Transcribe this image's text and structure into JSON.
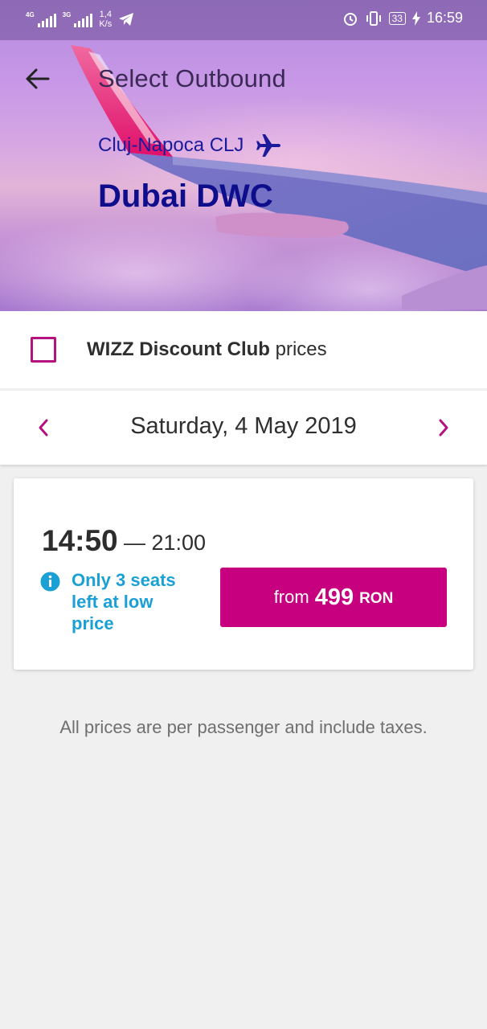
{
  "status_bar": {
    "network1": "4G",
    "network2": "3G",
    "speed_value": "1,4",
    "speed_unit": "K/s",
    "battery": "33",
    "time": "16:59",
    "icons": [
      "telegram-icon",
      "alarm-icon",
      "vibrate-icon",
      "battery-icon",
      "charging-icon"
    ]
  },
  "header": {
    "title": "Select Outbound",
    "origin": "Cluj-Napoca CLJ",
    "destination": "Dubai DWC"
  },
  "club": {
    "label_bold": "WIZZ Discount Club",
    "label_rest": " prices",
    "checked": false
  },
  "date_nav": {
    "date": "Saturday, 4 May 2019"
  },
  "flight": {
    "departure": "14:50",
    "arrival_text": "— 21:00",
    "seats_notice": "Only 3 seats left at low price",
    "price_prefix": "from",
    "price": "499",
    "currency": "RON"
  },
  "footnote": "All prices are per passenger and include taxes.",
  "colors": {
    "accent": "#c6007e",
    "destination": "#0e0e8c",
    "info": "#1aa0d4"
  }
}
